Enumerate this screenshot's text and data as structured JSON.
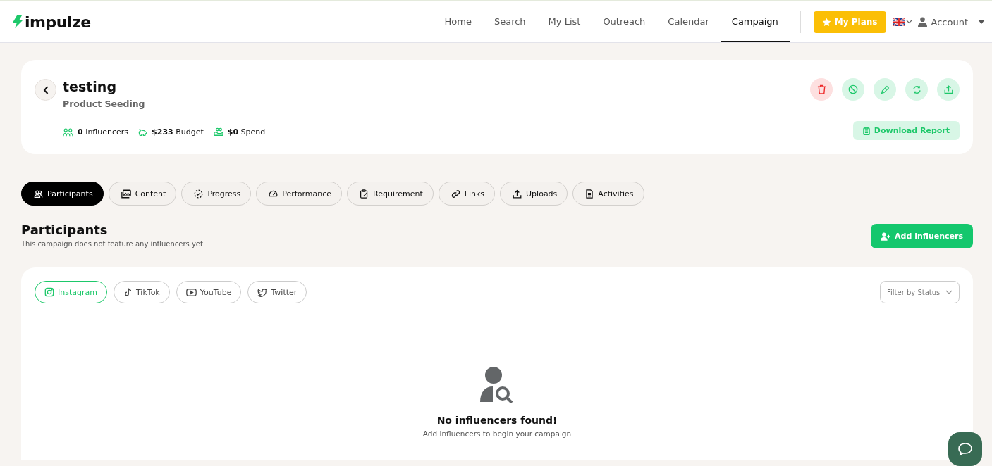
{
  "header": {
    "logo": "impulze",
    "nav": [
      {
        "label": "Home",
        "selected": false
      },
      {
        "label": "Search",
        "selected": false
      },
      {
        "label": "My List",
        "selected": false
      },
      {
        "label": "Outreach",
        "selected": false
      },
      {
        "label": "Calendar",
        "selected": false
      },
      {
        "label": "Campaign",
        "selected": true
      }
    ],
    "plans_button": "My Plans",
    "account": "Account"
  },
  "campaign": {
    "title": "testing",
    "type": "Product Seeding",
    "stats": [
      {
        "text": "**0** Influencers"
      },
      {
        "text": "**$233** Budget"
      },
      {
        "text": "**$0** Spend"
      }
    ],
    "download_button": "Download Report"
  },
  "tabs": [
    {
      "label": "Participants",
      "selected": true
    },
    {
      "label": "Content",
      "selected": false
    },
    {
      "label": "Progress",
      "selected": false
    },
    {
      "label": "Performance",
      "selected": false
    },
    {
      "label": "Requirement",
      "selected": false
    },
    {
      "label": "Links",
      "selected": false
    },
    {
      "label": "Uploads",
      "selected": false
    },
    {
      "label": "Activities",
      "selected": false
    }
  ],
  "section": {
    "title": "Participants",
    "subtitle": "This campaign does not feature any influencers yet",
    "add_button": "Add influencers"
  },
  "platforms": [
    {
      "label": "Instagram",
      "selected": true
    },
    {
      "label": "TikTok",
      "selected": false
    },
    {
      "label": "YouTube",
      "selected": false
    },
    {
      "label": "Twitter",
      "selected": false
    }
  ],
  "filter": {
    "placeholder": "Filter by Status"
  },
  "empty_state": {
    "title": "No influencers found!",
    "message": "Add influencers to begin your campaign"
  }
}
